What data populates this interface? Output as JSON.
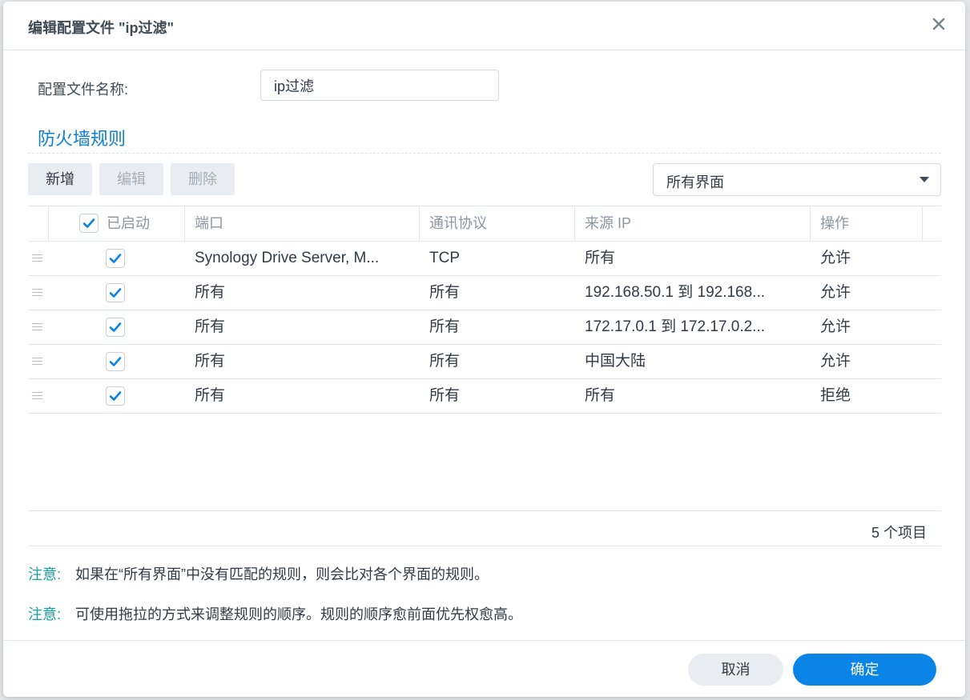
{
  "dialog": {
    "title": "编辑配置文件 \"ip过滤\"",
    "close_icon": "close-icon"
  },
  "profile": {
    "name_label": "配置文件名称:",
    "name_value": "ip过滤"
  },
  "section": {
    "title": "防火墙规则"
  },
  "toolbar": {
    "add_label": "新增",
    "edit_label": "编辑",
    "delete_label": "删除",
    "interface_selected": "所有界面"
  },
  "table": {
    "headers": {
      "enabled": "已启动",
      "port": "端口",
      "protocol": "通讯协议",
      "source_ip": "来源 IP",
      "action": "操作"
    },
    "rows": [
      {
        "enabled": true,
        "port": "Synology Drive Server, M...",
        "protocol": "TCP",
        "source_ip": "所有",
        "action": "允许"
      },
      {
        "enabled": true,
        "port": "所有",
        "protocol": "所有",
        "source_ip": "192.168.50.1 到 192.168...",
        "action": "允许"
      },
      {
        "enabled": true,
        "port": "所有",
        "protocol": "所有",
        "source_ip": "172.17.0.1 到 172.17.0.2...",
        "action": "允许"
      },
      {
        "enabled": true,
        "port": "所有",
        "protocol": "所有",
        "source_ip": "中国大陆",
        "action": "允许"
      },
      {
        "enabled": true,
        "port": "所有",
        "protocol": "所有",
        "source_ip": "所有",
        "action": "拒绝"
      }
    ],
    "item_count": "5 个项目"
  },
  "notes": [
    {
      "label": "注意:",
      "text": "如果在“所有界面”中没有匹配的规则，则会比对各个界面的规则。"
    },
    {
      "label": "注意:",
      "text": "可使用拖拉的方式来调整规则的顺序。规则的顺序愈前面优先权愈高。"
    }
  ],
  "footer": {
    "cancel_label": "取消",
    "ok_label": "确定"
  },
  "colors": {
    "accent": "#0b84e8",
    "section_title": "#0b7fd9",
    "note_label": "#17a2a2"
  }
}
